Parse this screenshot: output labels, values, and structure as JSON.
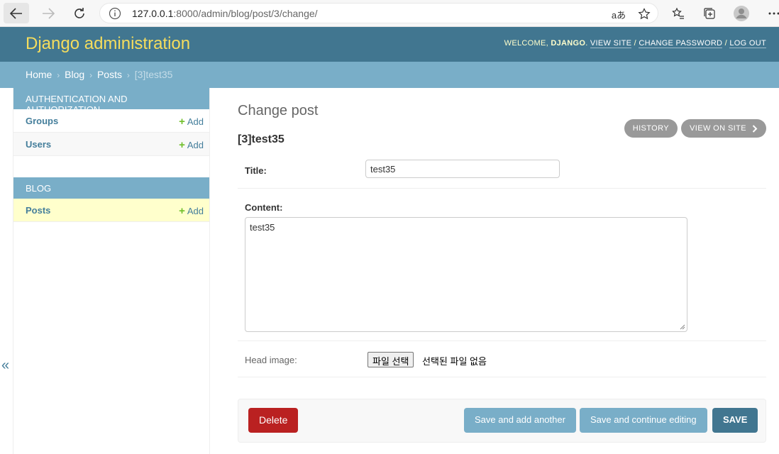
{
  "browser": {
    "url_host": "127.0.0.1",
    "url_path": ":8000/admin/blog/post/3/change/",
    "read_aloud_label": "aあ"
  },
  "header": {
    "branding": "Django administration",
    "welcome": "WELCOME,",
    "username": "DJANGO",
    "view_site": "VIEW SITE",
    "change_password": "CHANGE PASSWORD",
    "log_out": "LOG OUT",
    "separator": "/"
  },
  "breadcrumbs": {
    "home": "Home",
    "blog": "Blog",
    "posts": "Posts",
    "current": "[3]test35",
    "sep": "›"
  },
  "sidebar": {
    "auth_caption": "AUTHENTICATION AND AUTHORIZATION",
    "auth_items": [
      {
        "label": "Groups",
        "add": "Add"
      },
      {
        "label": "Users",
        "add": "Add"
      }
    ],
    "blog_caption": "BLOG",
    "blog_items": [
      {
        "label": "Posts",
        "add": "Add"
      }
    ],
    "collapse": "«"
  },
  "main": {
    "title": "Change post",
    "subtitle": "[3]test35",
    "history": "HISTORY",
    "view_on_site": "VIEW ON SITE",
    "fields": {
      "title_label": "Title:",
      "title_value": "test35",
      "content_label": "Content:",
      "content_value": "test35",
      "head_image_label": "Head image:",
      "file_button": "파일 선택",
      "file_none": "선택된 파일 없음"
    },
    "buttons": {
      "delete": "Delete",
      "save_add_another": "Save and add another",
      "save_continue": "Save and continue editing",
      "save": "SAVE"
    }
  },
  "colors": {
    "header": "#417690",
    "breadcrumbs": "#79aec8",
    "branding": "#f5dd5d",
    "delete": "#ba2121",
    "current_row": "#ffffcc"
  }
}
